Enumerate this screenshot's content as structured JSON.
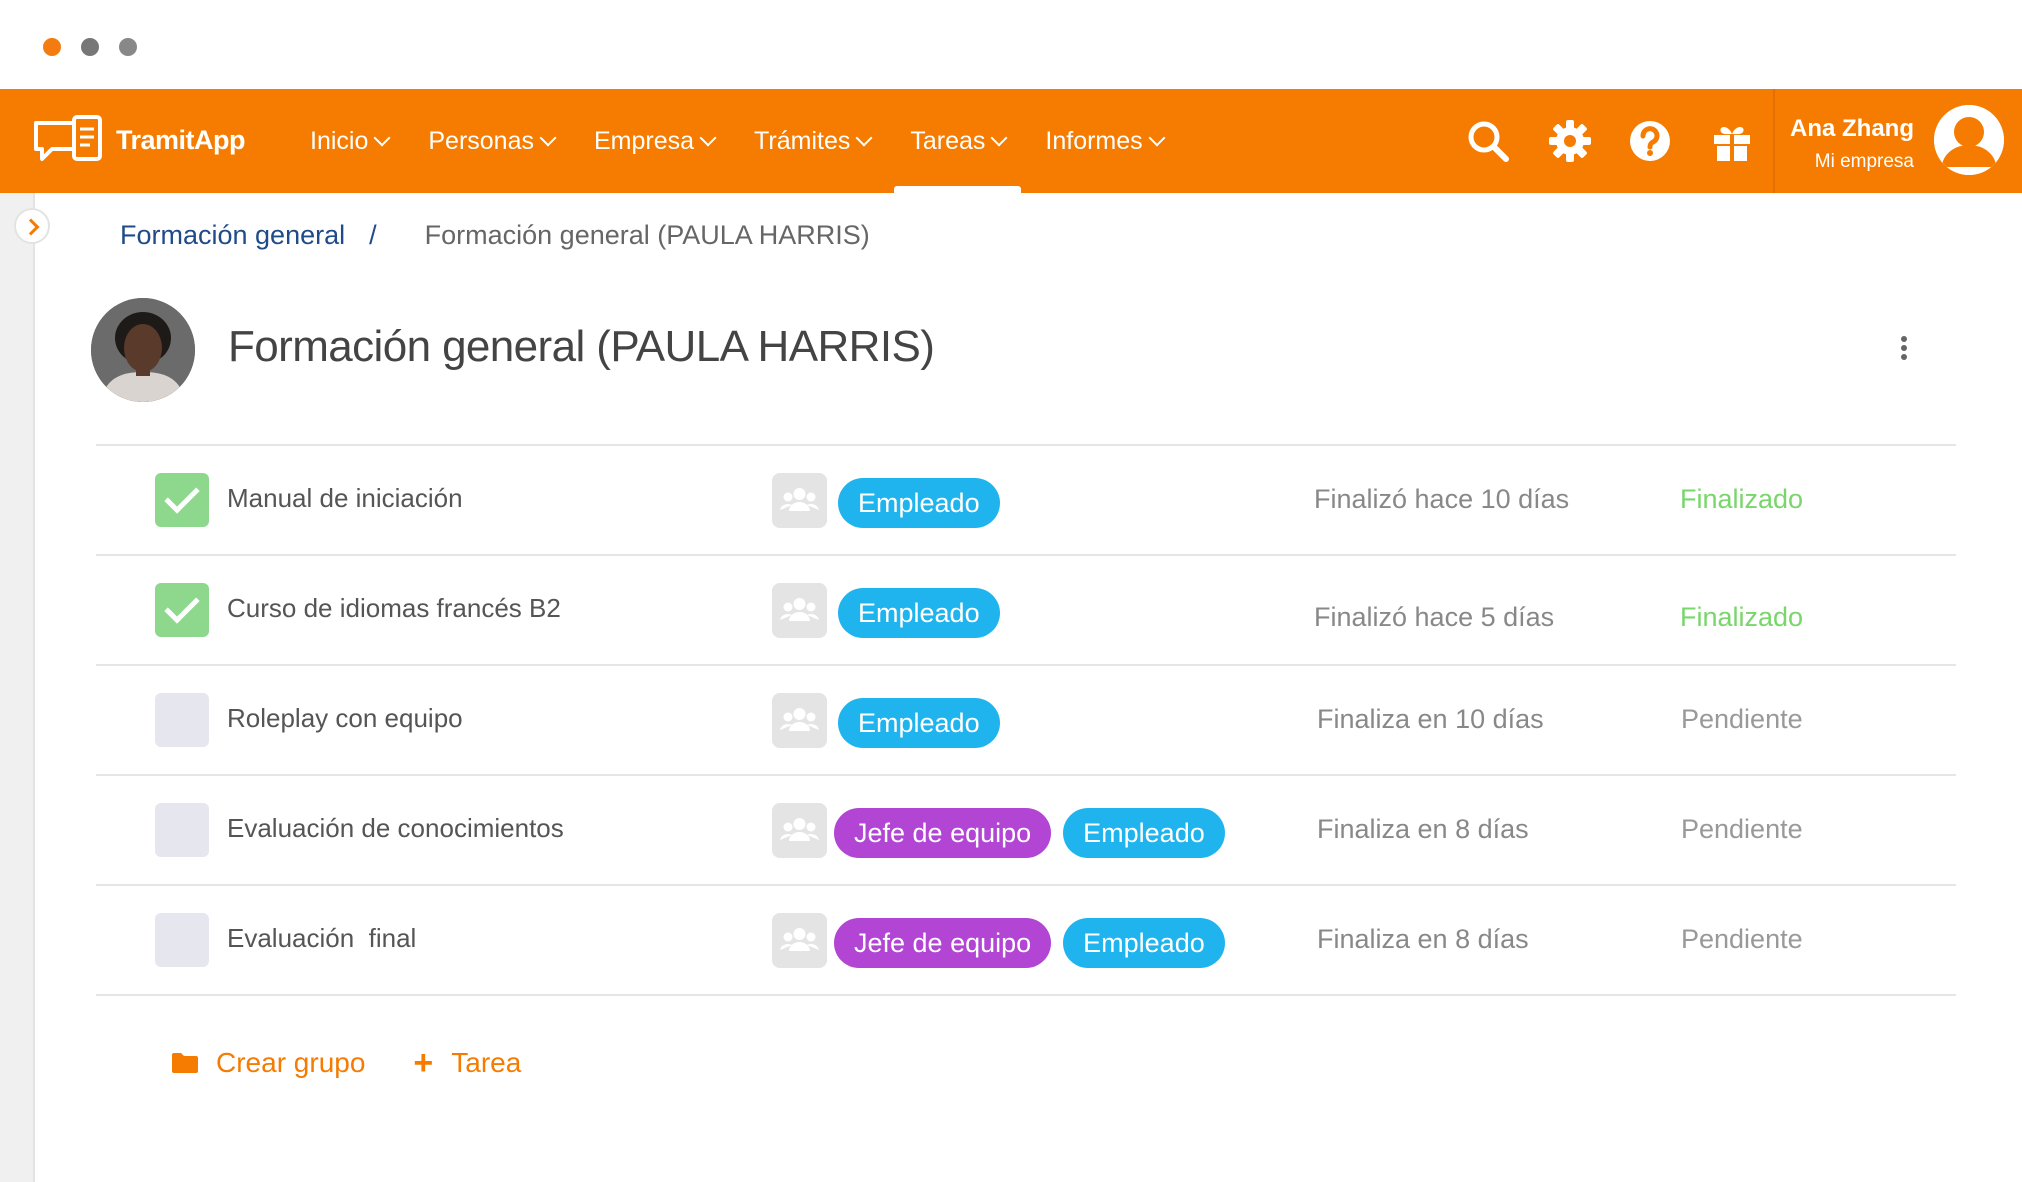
{
  "app": {
    "logo_brand": "Tramit",
    "logo_suffix": "App"
  },
  "nav": {
    "items": [
      {
        "label": "Inicio",
        "active": false
      },
      {
        "label": "Personas",
        "active": false
      },
      {
        "label": "Empresa",
        "active": false
      },
      {
        "label": "Trámites",
        "active": false
      },
      {
        "label": "Tareas",
        "active": true
      },
      {
        "label": "Informes",
        "active": false
      }
    ],
    "icons": [
      "search-icon",
      "gear-icon",
      "help-icon",
      "gift-icon"
    ],
    "accent_color": "#f57c00"
  },
  "user": {
    "name": "Ana Zhang",
    "company": "Mi empresa"
  },
  "breadcrumb": {
    "parent": "Formación general",
    "separator": "/",
    "current": "Formación general (PAULA HARRIS)"
  },
  "header": {
    "title": "Formación general (PAULA HARRIS)"
  },
  "tasks": [
    {
      "name": "Manual de iniciación",
      "done": true,
      "tags": [
        "Empleado"
      ],
      "due": "Finalizó hace 10 días",
      "status": "Finalizado"
    },
    {
      "name": "Curso de idiomas francés B2",
      "done": true,
      "tags": [
        "Empleado"
      ],
      "due": "Finalizó hace 5 días",
      "status": "Finalizado"
    },
    {
      "name": "Roleplay con equipo",
      "done": false,
      "tags": [
        "Empleado"
      ],
      "due": "Finaliza en 10 días",
      "status": "Pendiente"
    },
    {
      "name": "Evaluación de conocimientos",
      "done": false,
      "tags": [
        "Jefe de equipo",
        "Empleado"
      ],
      "due": "Finaliza en 8 días",
      "status": "Pendiente"
    },
    {
      "name": "Evaluación  final",
      "done": false,
      "tags": [
        "Jefe de equipo",
        "Empleado"
      ],
      "due": "Finaliza en 8 días",
      "status": "Pendiente"
    }
  ],
  "tag_colors": {
    "Empleado": "#1fb4ee",
    "Jefe de equipo": "#b245d4"
  },
  "status_colors": {
    "Finalizado": "#78d66a",
    "Pendiente": "#999999"
  },
  "actions": {
    "create_group": "Crear grupo",
    "add_task": "Tarea"
  }
}
